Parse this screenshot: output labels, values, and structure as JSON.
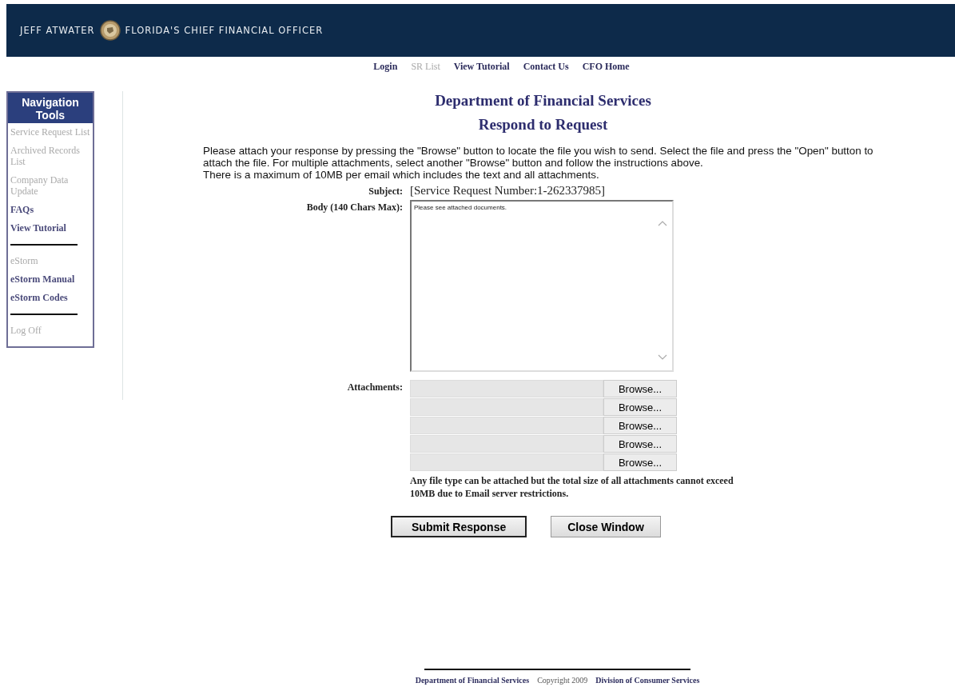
{
  "header": {
    "name": "JEFF ATWATER",
    "title": "FLORIDA'S CHIEF FINANCIAL OFFICER"
  },
  "top_nav": [
    {
      "label": "Login",
      "disabled": false
    },
    {
      "label": "SR List",
      "disabled": true
    },
    {
      "label": "View Tutorial",
      "disabled": false
    },
    {
      "label": "Contact Us",
      "disabled": false
    },
    {
      "label": "CFO Home",
      "disabled": false
    }
  ],
  "sidebar": {
    "title": "Navigation Tools",
    "groups": [
      [
        {
          "label": "Service Request List",
          "disabled": true
        },
        {
          "label": "Archived Records List",
          "disabled": true
        },
        {
          "label": "Company Data Update",
          "disabled": true
        },
        {
          "label": "FAQs",
          "disabled": false
        },
        {
          "label": "View Tutorial",
          "disabled": false
        }
      ],
      [
        {
          "label": "eStorm",
          "disabled": true
        },
        {
          "label": "eStorm Manual",
          "disabled": false
        },
        {
          "label": "eStorm Codes",
          "disabled": false
        }
      ],
      [
        {
          "label": "Log Off",
          "disabled": true
        }
      ]
    ]
  },
  "heading": "Department of Financial Services",
  "subheading": "Respond to Request",
  "instructions": [
    "Please attach your response by pressing the \"Browse\" button to locate the file you wish to send. Select the file and press the \"Open\" button to attach the file. For multiple attachments, select another \"Browse\" button and follow the instructions above.",
    "There is a maximum of 10MB per email which includes the text and all attachments."
  ],
  "subject": {
    "label": "Subject:",
    "value": "[Service Request Number:1-262337985]"
  },
  "body": {
    "label": "Body (140 Chars Max):",
    "value": "Please see attached documents."
  },
  "attachments": {
    "label": "Attachments:",
    "rows": [
      {
        "button": "Browse..."
      },
      {
        "button": "Browse..."
      },
      {
        "button": "Browse..."
      },
      {
        "button": "Browse..."
      },
      {
        "button": "Browse..."
      }
    ],
    "note": "Any file type can be attached but the total size of all attachments cannot exceed 10MB due to Email server restrictions."
  },
  "buttons": [
    {
      "label": "Submit Response",
      "selected": true
    },
    {
      "label": "Close Window",
      "selected": false
    }
  ],
  "footer": [
    "Department of Financial Services",
    "Copyright 2009",
    "Division of Consumer Services"
  ]
}
